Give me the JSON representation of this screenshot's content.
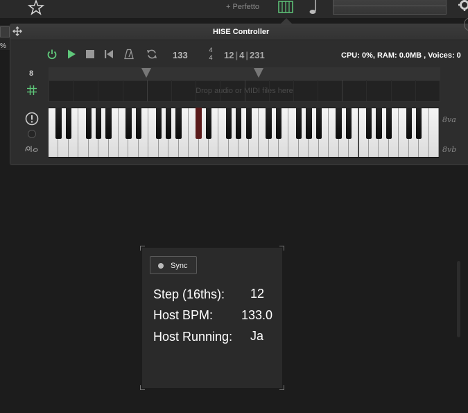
{
  "toolbar": {
    "preset_label": "+ Perfetto",
    "icons": [
      "star-icon",
      "piano-keys-icon",
      "note-icon",
      "gear-icon"
    ],
    "accent": "#5fc77a"
  },
  "background_window": {
    "percent_label": "%"
  },
  "panel": {
    "title": "HISE Controller",
    "transport": {
      "icons": [
        "power-icon",
        "play-icon",
        "stop-icon",
        "rewind-icon",
        "metronome-icon",
        "loop-icon"
      ],
      "tempo": "133",
      "sig_num": "4",
      "sig_den": "4",
      "pos_bar": "12",
      "pos_beat": "4",
      "pos_tick": "231",
      "sep": "|"
    },
    "stats": "CPU: 0%, RAM: 0.0MB , Voices: 0",
    "sequencer": {
      "octave_num": "8",
      "drop_text": "Drop audio or MIDI files here"
    },
    "keyboard": {
      "upper_label": "8va",
      "lower_label": "8vb"
    }
  },
  "widget": {
    "sync_label": "Sync",
    "rows": [
      {
        "label": "Step (16ths):",
        "value": "12"
      },
      {
        "label": "Host BPM:",
        "value": "133.0"
      },
      {
        "label": "Host Running:",
        "value": "Ja"
      }
    ]
  }
}
